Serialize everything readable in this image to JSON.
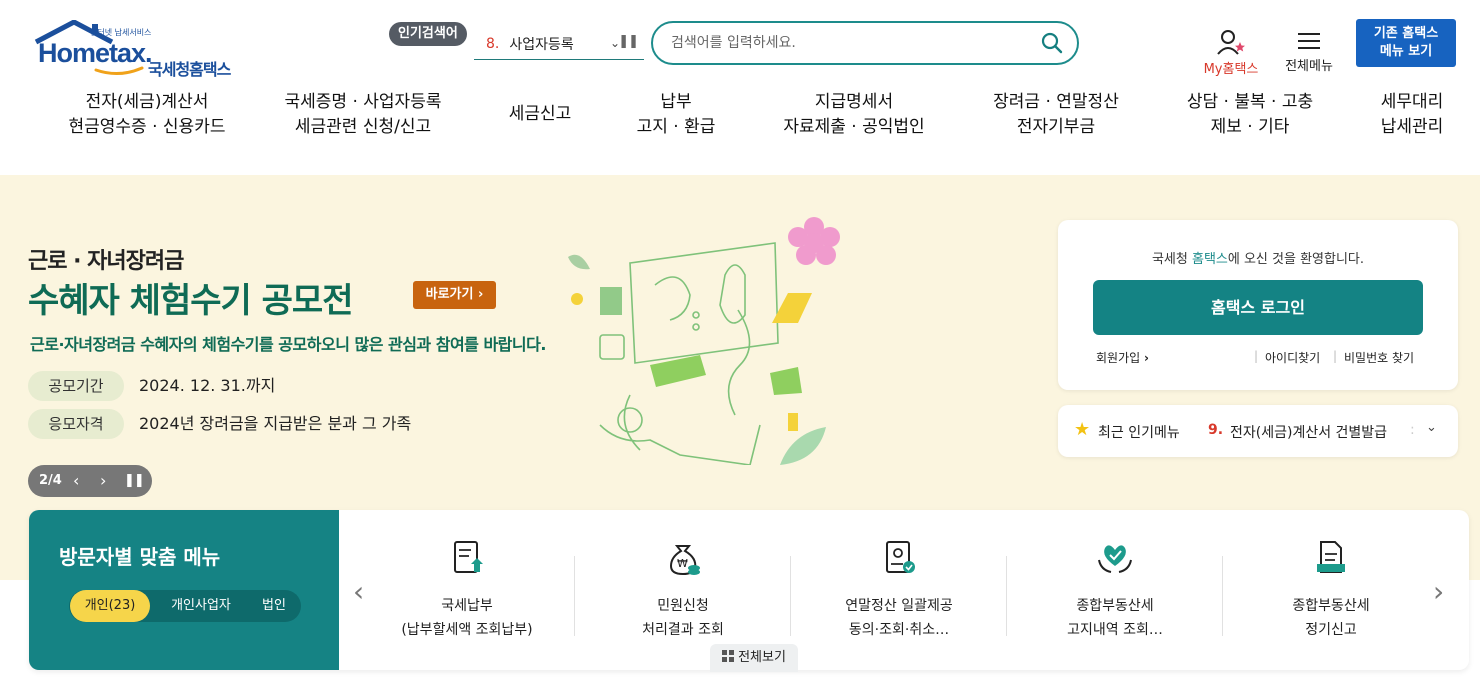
{
  "header": {
    "logo": {
      "small_caption": "인터넷 납세서비스",
      "wordmark": "Hometax.",
      "korean_name": "국세청홈택스"
    },
    "popular_search": {
      "badge": "인기검색어",
      "rank": "8.",
      "keyword": "사업자등록"
    },
    "search": {
      "placeholder": "검색어를 입력하세요."
    },
    "my_hometax": "My홈택스",
    "all_menu": "전체메뉴",
    "old_menu": {
      "line1": "기존 홈택스",
      "line2": "메뉴 보기"
    }
  },
  "gnb": [
    {
      "line1": "전자(세금)계산서",
      "line2": "현금영수증 · 신용카드"
    },
    {
      "line1": "국세증명 · 사업자등록",
      "line2": "세금관련 신청/신고"
    },
    {
      "line1": "세금신고",
      "line2": ""
    },
    {
      "line1": "납부",
      "line2": "고지 · 환급"
    },
    {
      "line1": "지급명세서",
      "line2": "자료제출 · 공익법인"
    },
    {
      "line1": "장려금 · 연말정산",
      "line2": "전자기부금"
    },
    {
      "line1": "상담 · 불복 · 고충",
      "line2": "제보 · 기타"
    },
    {
      "line1": "세무대리",
      "line2": "납세관리"
    }
  ],
  "hero": {
    "subtitle": "근로 · 자녀장려금",
    "title": "수혜자 체험수기 공모전",
    "go_button": "바로가기",
    "description": "근로·자녀장려금 수혜자의 체험수기를 공모하오니 많은 관심과 참여를 바랍니다.",
    "period_label": "공모기간",
    "period_value": "2024. 12. 31.까지",
    "eligibility_label": "응모자격",
    "eligibility_value": "2024년 장려금을 지급받은 분과 그 가족",
    "slide_indicator": "2/4"
  },
  "login": {
    "welcome_prefix": "국세청 ",
    "welcome_highlight": "홈택스",
    "welcome_suffix": "에 오신 것을 환영합니다.",
    "login_button": "홈택스 로그인",
    "signup": "회원가입",
    "find_id": "아이디찾기",
    "find_pw": "비밀번호 찾기"
  },
  "recent_popular": {
    "title": "최근 인기메뉴",
    "rank": "9.",
    "item": "전자(세금)계산서 건별발급"
  },
  "visitor_menu": {
    "title": "방문자별 맞춤 메뉴",
    "tabs": [
      "개인(23)",
      "개인사업자",
      "법인"
    ],
    "active_tab": "개인(23)",
    "cards": [
      {
        "icon": "tax-payment-icon",
        "line1": "국세납부",
        "line2": "(납부할세액 조회납부)"
      },
      {
        "icon": "money-bag-icon",
        "line1": "민원신청",
        "line2": "처리결과 조회"
      },
      {
        "icon": "document-stamp-icon",
        "line1": "연말정산 일괄제공",
        "line2": "동의·조회·취소…"
      },
      {
        "icon": "heart-hands-icon",
        "line1": "종합부동산세",
        "line2": "고지내역 조회…"
      },
      {
        "icon": "form-document-icon",
        "line1": "종합부동산세",
        "line2": "정기신고"
      }
    ],
    "view_all": "전체보기"
  },
  "colors": {
    "teal": "#158384",
    "brand_blue": "#1b4f9c",
    "accent_red": "#d8392b",
    "hero_bg": "#fbf5df",
    "hero_green": "#0f6b55",
    "go_button": "#c8640f",
    "tab_active": "#f6d54a"
  }
}
